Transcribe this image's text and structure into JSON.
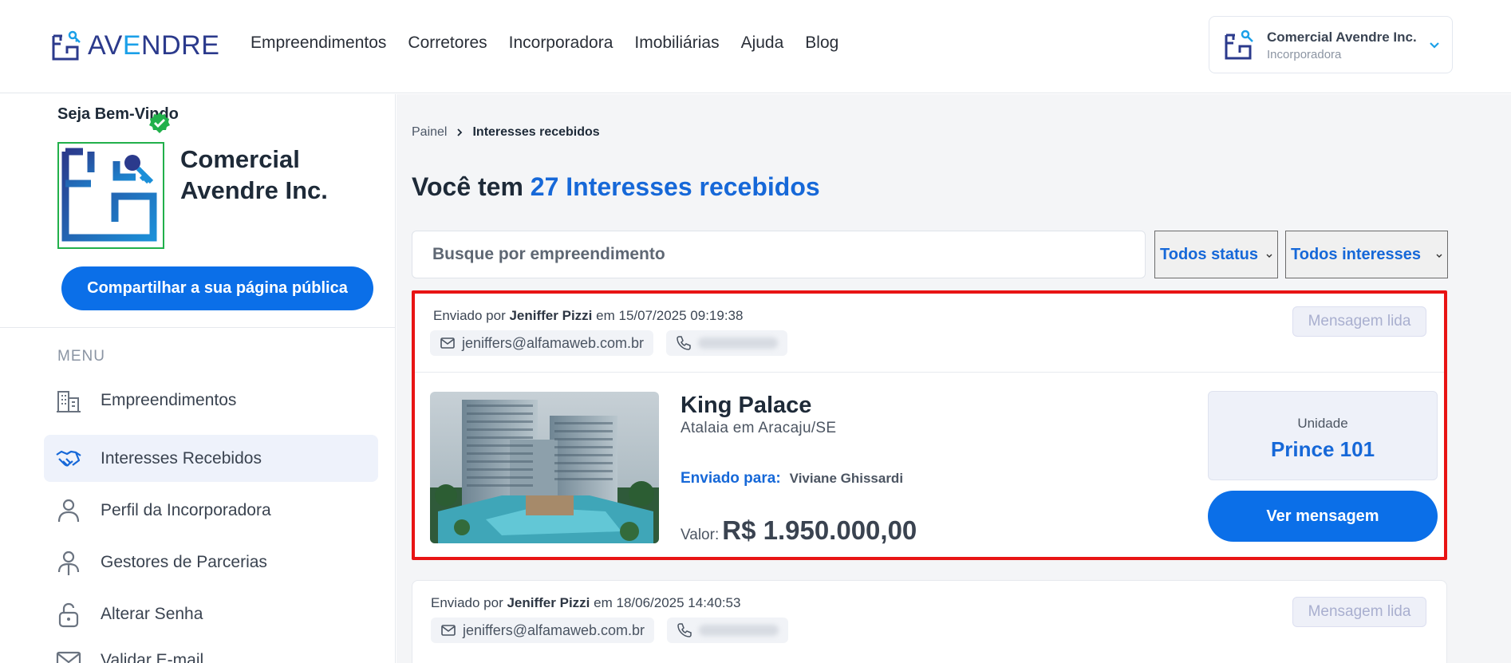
{
  "header": {
    "logo_text_a": "AV",
    "logo_text_e": "E",
    "logo_text_b": "NDRE",
    "nav": [
      "Empreendimentos",
      "Corretores",
      "Incorporadora",
      "Imobiliárias",
      "Ajuda",
      "Blog"
    ],
    "account": {
      "name": "Comercial Avendre Inc.",
      "role": "Incorporadora"
    }
  },
  "sidebar": {
    "welcome": "Seja Bem-Vindo",
    "company_name": "Comercial Avendre Inc.",
    "share_button": "Compartilhar a sua página pública",
    "menu_title": "MENU",
    "items": [
      {
        "label": "Empreendimentos",
        "icon": "building-icon"
      },
      {
        "label": "Interesses Recebidos",
        "icon": "handshake-icon",
        "active": true
      },
      {
        "label": "Perfil da Incorporadora",
        "icon": "user-icon"
      },
      {
        "label": "Gestores de Parcerias",
        "icon": "user-manager-icon"
      },
      {
        "label": "Alterar Senha",
        "icon": "lock-icon"
      },
      {
        "label": "Validar E-mail",
        "icon": "mail-icon"
      }
    ]
  },
  "main": {
    "breadcrumb": {
      "root": "Painel",
      "current": "Interesses recebidos"
    },
    "title_prefix": "Você tem",
    "title_accent": "27 Interesses recebidos",
    "search_placeholder": "Busque por empreendimento",
    "filter_status": "Todos status",
    "filter_interest": "Todos interesses"
  },
  "cards": [
    {
      "sent_prefix": "Enviado por",
      "sender": "Jeniffer Pizzi",
      "date_prefix": "em",
      "date": "15/07/2025 09:19:38",
      "email": "jeniffers@alfamaweb.com.br",
      "status": "Mensagem lida",
      "property": "King Palace",
      "location": "Atalaia em Aracaju/SE",
      "sent_to_label": "Enviado para:",
      "sent_to": "Viviane Ghissardi",
      "price_label": "Valor:",
      "price": "R$ 1.950.000,00",
      "unit_label": "Unidade",
      "unit": "Prince 101",
      "button": "Ver mensagem"
    },
    {
      "sent_prefix": "Enviado por",
      "sender": "Jeniffer Pizzi",
      "date_prefix": "em",
      "date": "18/06/2025 14:40:53",
      "email": "jeniffers@alfamaweb.com.br",
      "status": "Mensagem lida"
    }
  ],
  "colors": {
    "primary": "#0b6fe8",
    "accent_text": "#1668d8",
    "highlight": "#e81414",
    "verified": "#21b04b"
  }
}
